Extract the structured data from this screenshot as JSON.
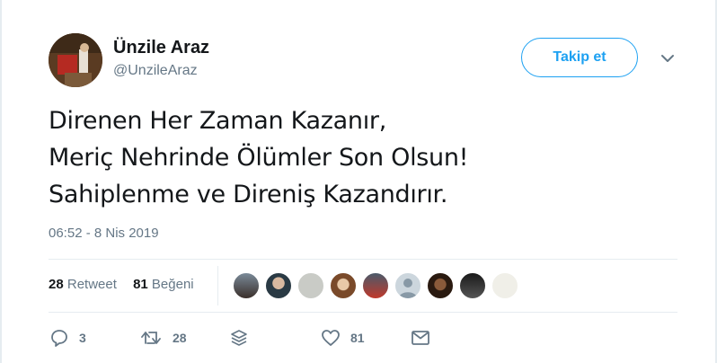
{
  "user": {
    "name": "Ünzile Araz",
    "handle": "@UnzileAraz"
  },
  "follow_button": "Takip et",
  "tweet_lines": [
    "Direnen Her Zaman Kazanır,",
    "Meriç Nehrinde Ölümler Son Olsun!",
    "Sahiplenme ve Direniş Kazandırır."
  ],
  "timestamp": "06:52 - 8 Nis 2019",
  "stats": {
    "retweet_count": "28",
    "retweet_label": "Retweet",
    "like_count": "81",
    "like_label": "Beğeni"
  },
  "actions": {
    "reply_count": "3",
    "retweet_count": "28",
    "like_count": "81"
  },
  "colors": {
    "accent": "#1da1f2",
    "secondary_text": "#657786",
    "divider": "#e6ecf0"
  }
}
